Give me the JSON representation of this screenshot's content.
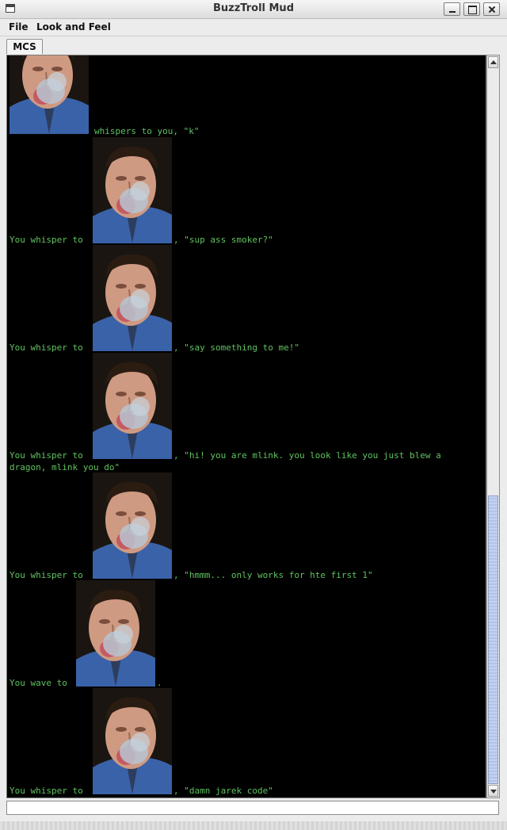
{
  "window": {
    "title": "BuzzTroll Mud"
  },
  "menu": {
    "file": "File",
    "look_and_feel": "Look and Feel"
  },
  "tabs": [
    {
      "label": "MCS"
    }
  ],
  "chat": {
    "lines": [
      {
        "prefix": "",
        "suffix": " whispers to you, \"k\"",
        "continuation": ""
      },
      {
        "prefix": "You whisper to ",
        "suffix": ", \"sup ass smoker?\"",
        "continuation": ""
      },
      {
        "prefix": "You whisper to ",
        "suffix": ", \"say something to me!\"",
        "continuation": ""
      },
      {
        "prefix": "You whisper to ",
        "suffix": ", \"hi! you are mlink.  you look like you just blew a",
        "continuation": "dragon, mlink you do\""
      },
      {
        "prefix": "You whisper to ",
        "suffix": ", \"hmmm... only works for hte first 1\"",
        "continuation": ""
      },
      {
        "prefix": "You wave to ",
        "suffix": ".",
        "continuation": ""
      },
      {
        "prefix": "You whisper to ",
        "suffix": ", \"damn jarek code\"",
        "continuation": ""
      }
    ],
    "avatar_icon": "player-avatar-photo",
    "text_color": "#5fc35f",
    "background": "#000000"
  },
  "input": {
    "value": ""
  }
}
